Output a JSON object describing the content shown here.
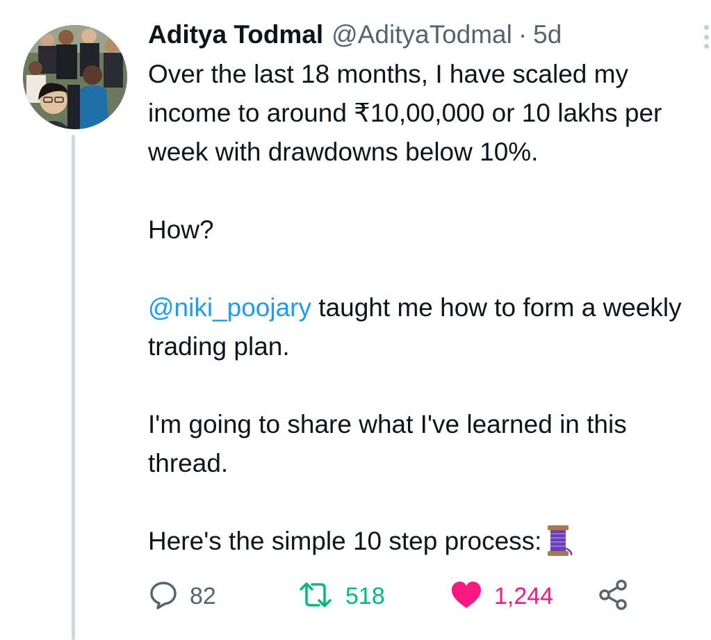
{
  "tweet": {
    "author_name": "Aditya Todmal",
    "author_handle": "@AdityaTodmal",
    "separator": "·",
    "time_ago": "5d",
    "line1": "Over the last 18 months, I have scaled my income to around ₹10,00,000 or 10 lakhs per week with drawdowns below 10%.",
    "line2": "How?",
    "mention": "@niki_poojary",
    "line3_rest": " taught me how to form a weekly trading plan.",
    "line4": "I'm going to share what I've learned in this thread.",
    "line5": "Here's the simple 10 step process:",
    "thread_emoji": "spool-of-thread-icon"
  },
  "stats": {
    "replies": "82",
    "retweets": "518",
    "likes": "1,244"
  },
  "colors": {
    "text": "#0f1419",
    "muted": "#536471",
    "mention": "#1d9bf0",
    "retweet": "#00ba7c",
    "like": "#f91880",
    "thread_line": "#cfd9de"
  }
}
